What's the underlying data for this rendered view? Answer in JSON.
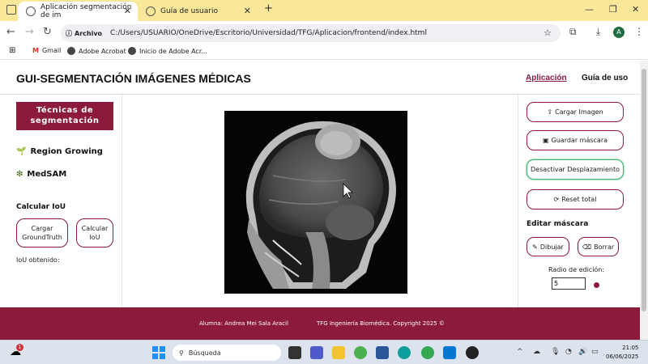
{
  "browser": {
    "tabs": [
      {
        "title": "Aplicación segmentación de im"
      },
      {
        "title": "Guía de usuario"
      }
    ],
    "new_tab": "+",
    "window_controls": {
      "minimize": "—",
      "maximize": "❐",
      "close": "✕"
    },
    "address": {
      "chip": "Archivo",
      "url": "C:/Users/USUARIO/OneDrive/Escritorio/Universidad/TFG/Aplicacion/frontend/index.html"
    },
    "profile_initial": "A",
    "bookmarks": [
      "Gmail",
      "Adobe Acrobat",
      "Inicio de Adobe Acr..."
    ]
  },
  "app": {
    "title": "GUI-SEGMENTACIÓN IMÁGENES MÉDICAS",
    "nav": {
      "app": "Aplicación",
      "guide": "Guía de uso"
    },
    "left": {
      "techniques_header": "Técnicas de segmentación",
      "techniques": [
        {
          "icon": "🌱",
          "label": "Region Growing"
        },
        {
          "icon": "❇",
          "label": "MedSAM"
        }
      ],
      "iou_title": "Calcular IoU",
      "load_groundtruth": "Cargar GroundTruth",
      "calc_iou": "Calcular IoU",
      "iou_result_label": "IoU obtenido:"
    },
    "right": {
      "load_image": "Cargar Imagen",
      "save_mask": "Guardar máscara",
      "disable_pan": "Desactivar Desplazamiento",
      "reset": "Reset total",
      "edit_title": "Editar máscara",
      "draw": "Dibujar",
      "erase": "Borrar",
      "radius_label": "Radio de edición:",
      "radius_value": "5",
      "mask_color": "#8b1a3b"
    },
    "footer": {
      "author": "Alumna: Andrea Mei Sala Aracil",
      "copyright": "TFG Ingeniería Biomédica. Copyright 2025 ©"
    }
  },
  "taskbar": {
    "search_placeholder": "Búsqueda",
    "time": "21:05",
    "date": "06/06/2025",
    "notification_count": "1"
  },
  "colors": {
    "brand": "#8b1a3b",
    "accent_green": "#3cb371",
    "tabbar": "#f9e79a"
  }
}
